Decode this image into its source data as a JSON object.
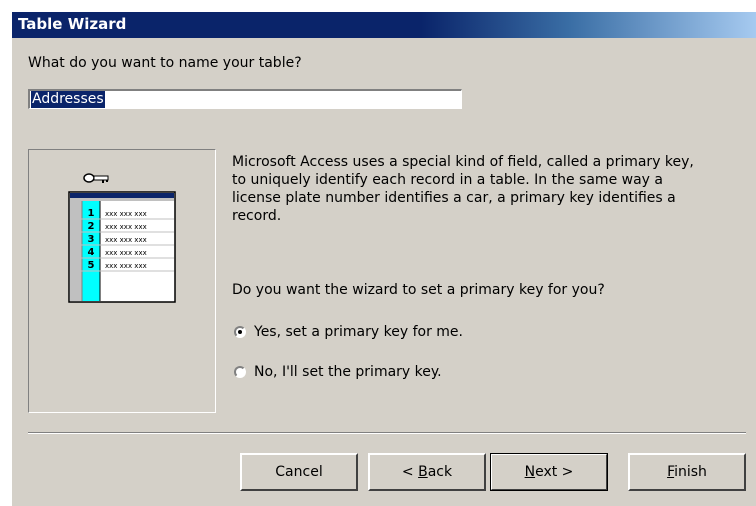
{
  "window": {
    "title": "Table Wizard"
  },
  "prompt": {
    "question": "What do you want to name your table?",
    "table_name_value": "Addresses"
  },
  "illustration": {
    "row_numbers": [
      "1",
      "2",
      "3",
      "4",
      "5"
    ],
    "cell_text": "xxx xxx xxx",
    "icon": "key-icon"
  },
  "description": "Microsoft Access uses a special kind of field, called a primary key,\nto uniquely identify each record in a table. In the same way a\nlicense plate number identifies a car, a primary key identifies a\nrecord.",
  "primary_key": {
    "question": "Do you want the wizard to set a primary key for you?",
    "options": [
      {
        "label": "Yes, set a primary key for me.",
        "selected": true
      },
      {
        "label": "No, I'll set the primary key.",
        "selected": false
      }
    ]
  },
  "buttons": {
    "cancel": {
      "label": "Cancel"
    },
    "back": {
      "pre": "< ",
      "mnemonic": "B",
      "post": "ack"
    },
    "next": {
      "pre": "",
      "mnemonic": "N",
      "post": "ext >"
    },
    "finish": {
      "pre": "",
      "mnemonic": "F",
      "post": "inish"
    }
  },
  "colors": {
    "title_bar": "#0a246a",
    "dialog_face": "#d4d0c8",
    "selection": "#0a246a",
    "row_number_fill": "#00ffff"
  }
}
